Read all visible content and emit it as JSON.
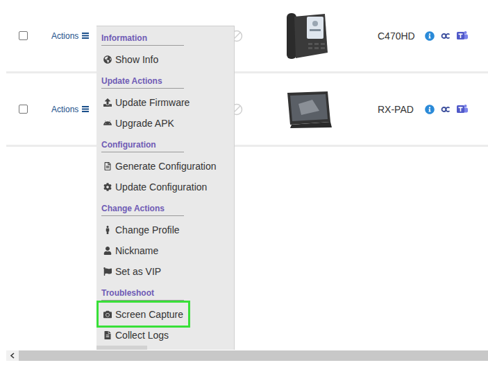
{
  "rows": [
    {
      "checked": false,
      "actions": "Actions",
      "model": "C470HD",
      "kind": "desk-phone"
    },
    {
      "checked": false,
      "actions": "Actions",
      "model": "RX-PAD",
      "kind": "tablet"
    }
  ],
  "menu": {
    "sections": [
      {
        "title": "Information",
        "items": [
          {
            "label": "Show Info",
            "highlighted": false
          }
        ]
      },
      {
        "title": "Update Actions",
        "items": [
          {
            "label": "Update Firmware",
            "highlighted": false
          },
          {
            "label": "Upgrade APK",
            "highlighted": false
          }
        ]
      },
      {
        "title": "Configuration",
        "items": [
          {
            "label": "Generate Configuration",
            "highlighted": false
          },
          {
            "label": "Update Configuration",
            "highlighted": false
          }
        ]
      },
      {
        "title": "Change Actions",
        "items": [
          {
            "label": "Change Profile",
            "highlighted": false
          },
          {
            "label": "Nickname",
            "highlighted": false
          },
          {
            "label": "Set as VIP",
            "highlighted": false
          }
        ]
      },
      {
        "title": "Troubleshoot",
        "items": [
          {
            "label": "Screen Capture",
            "highlighted": true
          },
          {
            "label": "Collect Logs",
            "highlighted": false
          }
        ]
      }
    ]
  }
}
